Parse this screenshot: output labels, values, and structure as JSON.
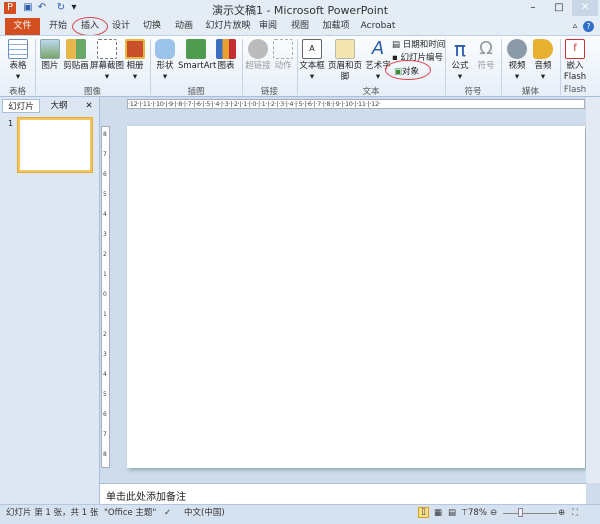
{
  "title": "演示文稿1 - Microsoft PowerPoint",
  "tabs": [
    "文件",
    "开始",
    "插入",
    "设计",
    "切换",
    "动画",
    "幻灯片放映",
    "审阅",
    "视图",
    "加载项",
    "Acrobat"
  ],
  "ribbon": {
    "buttons": [
      "表格",
      "图片",
      "剪贴画",
      "屏幕截图",
      "相册",
      "形状",
      "SmartArt",
      "图表",
      "超链接",
      "动作",
      "文本框",
      "页眉和页脚",
      "艺术字",
      "公式",
      "符号",
      "视频",
      "音频",
      "嵌入",
      "Flash"
    ],
    "small_buttons": [
      "日期和时间",
      "幻灯片编号",
      "对象"
    ],
    "groups": [
      "表格",
      "图像",
      "插图",
      "链接",
      "文本",
      "符号",
      "媒体",
      "Flash"
    ]
  },
  "panel": {
    "tabs": [
      "幻灯片",
      "大纲"
    ],
    "close": "✕",
    "slide_number": "1"
  },
  "ruler": {
    "h": "·12·|·11·|·10·|·9·|·8·|·7·|·6·|·5·|·4·|·3·|·2·|·1·|·0·|·1·|·2·|·3·|·4·|·5·|·6·|·7·|·8·|·9·|·10·|·11·|·12·",
    "v": [
      "8",
      "7",
      "6",
      "5",
      "4",
      "3",
      "2",
      "1",
      "0",
      "1",
      "2",
      "3",
      "4",
      "5",
      "6",
      "7",
      "8"
    ]
  },
  "notes_placeholder": "单击此处添加备注",
  "status": {
    "slide": "幻灯片 第 1 张，共 1 张",
    "theme": "\"Office 主题\"",
    "language": "中文(中国)",
    "zoom": "78%"
  },
  "colors": {
    "file_tab": "#d44f1f",
    "accent": "#f3c75a"
  }
}
